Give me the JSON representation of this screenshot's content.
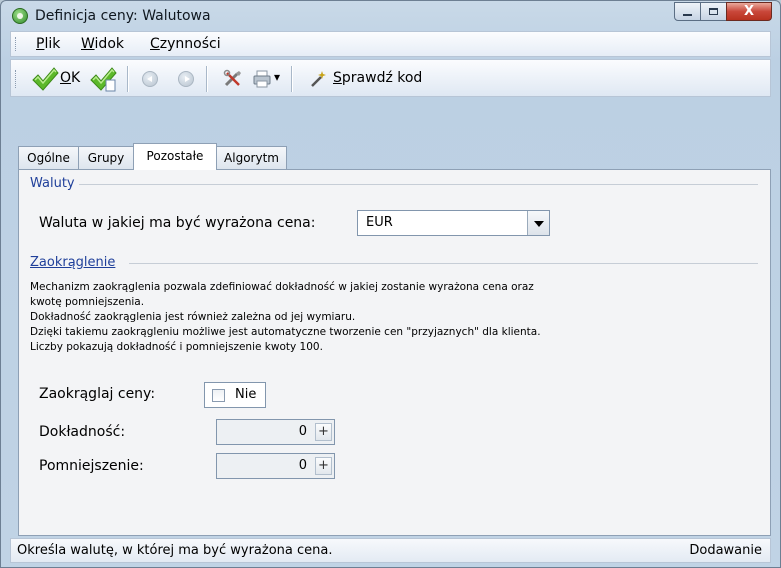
{
  "window": {
    "title": "Definicja ceny: Walutowa",
    "close_glyph": "X"
  },
  "menu": {
    "items": [
      {
        "accel": "P",
        "rest": "lik"
      },
      {
        "accel": "W",
        "rest": "idok"
      },
      {
        "accel": "C",
        "rest": "zynności"
      }
    ]
  },
  "toolbar": {
    "ok_accel": "O",
    "ok_rest": "K",
    "check_label_accel": "S",
    "check_label_rest": "prawdź kod",
    "dropdown_glyph": "▾"
  },
  "tabs": [
    {
      "label": "Ogólne",
      "active": false
    },
    {
      "label": "Grupy",
      "active": false
    },
    {
      "label": "Pozostałe",
      "active": true
    },
    {
      "label": "Algorytm",
      "active": false
    }
  ],
  "currency_section": {
    "title": "Waluty",
    "label": "Waluta w jakiej ma być wyrażona cena:",
    "value": "EUR"
  },
  "rounding_section": {
    "title": "Zaokrąglenie",
    "description": [
      "Mechanizm zaokrąglenia pozwala zdefiniować dokładność w jakiej zostanie wyrażona cena oraz",
      "kwotę pomniejszenia.",
      "Dokładność zaokrąglenia jest również zależna od jej wymiaru.",
      "Dzięki takiemu zaokrągleniu możliwe jest automatyczne tworzenie cen \"przyjaznych\" dla klienta.",
      "Liczby pokazują dokładność i pomniejszenie kwoty 100."
    ],
    "round_label": "Zaokrąglaj ceny:",
    "round_value": "Nie",
    "round_checked": false,
    "precision_label": "Dokładność:",
    "precision_value": "0",
    "reduction_label": "Pomniejszenie:",
    "reduction_value": "0",
    "stepper_glyph": "+"
  },
  "status": {
    "text": "Określa walutę, w której ma być wyrażona cena.",
    "mode": "Dodawanie"
  },
  "colors": {
    "accent": "#1f3f9a",
    "check_green": "#5cb82a",
    "close_red": "#c9473a"
  }
}
